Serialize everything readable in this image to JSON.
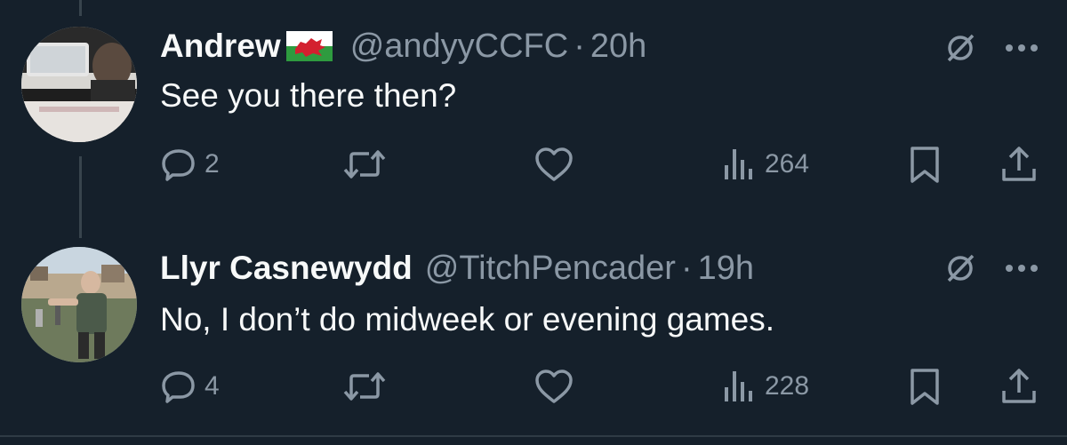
{
  "tweets": [
    {
      "name": "Andrew",
      "handle": "@andyyCCFC",
      "separator": "·",
      "time": "20h",
      "text": "See you there then?",
      "replies": "2",
      "views": "264",
      "icons": [
        "wales-flag-icon",
        "grok-icon",
        "more-icon",
        "reply-icon",
        "retweet-icon",
        "like-icon",
        "views-icon",
        "bookmark-icon",
        "share-icon"
      ]
    },
    {
      "name": "Llyr Casnewydd",
      "handle": "@TitchPencader",
      "separator": "·",
      "time": "19h",
      "text": "No, I don’t do midweek or evening games.",
      "replies": "4",
      "views": "228",
      "icons": [
        "grok-icon",
        "more-icon",
        "reply-icon",
        "retweet-icon",
        "like-icon",
        "views-icon",
        "bookmark-icon",
        "share-icon"
      ]
    }
  ],
  "colors": {
    "background": "#15202b",
    "primary_text": "#f7f9f9",
    "secondary_text": "#8b98a5",
    "thread_line": "#38444d"
  }
}
